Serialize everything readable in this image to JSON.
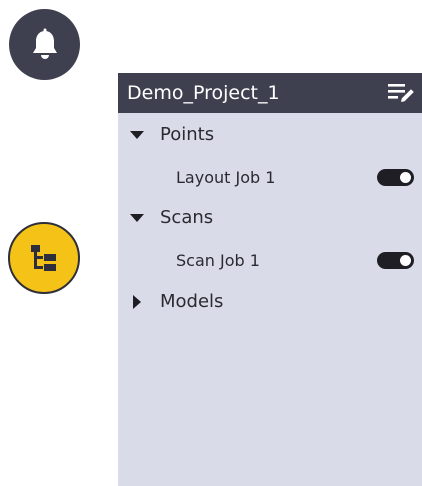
{
  "colors": {
    "header_bg": "#3e3f4f",
    "panel_bg": "#d9dce8",
    "accent_yellow": "#f5c318",
    "toggle_on": "#1e1e24"
  },
  "fab_buttons": [
    {
      "icon": "bell-icon"
    },
    {
      "icon": "layers-tree-icon"
    }
  ],
  "panel": {
    "title": "Demo_Project_1",
    "edit_icon": "edit-list-icon",
    "groups": [
      {
        "label": "Points",
        "expanded": true,
        "items": [
          {
            "label": "Layout Job 1",
            "visible": true
          }
        ]
      },
      {
        "label": "Scans",
        "expanded": true,
        "items": [
          {
            "label": "Scan Job 1",
            "visible": true
          }
        ]
      },
      {
        "label": "Models",
        "expanded": false,
        "items": []
      }
    ]
  }
}
